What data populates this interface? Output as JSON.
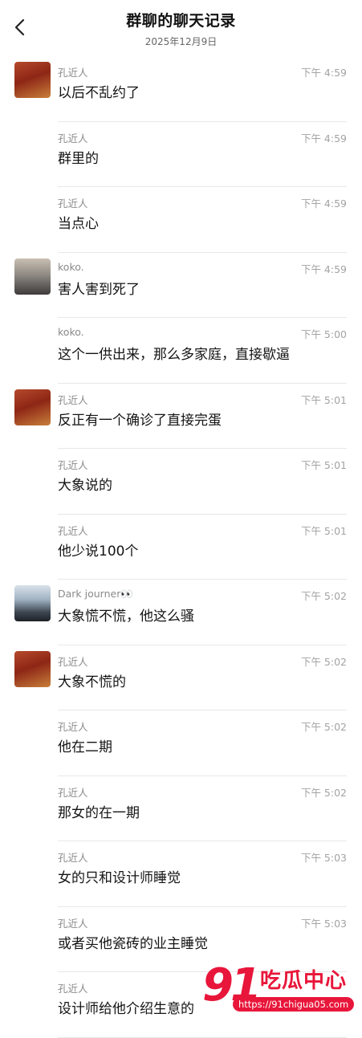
{
  "header": {
    "title": "群聊的聊天记录",
    "subtitle": "2025年12月9日"
  },
  "messages": [
    {
      "sender": "孔近人",
      "time": "下午 4:59",
      "text": "以后不乱约了",
      "avatar": "kong"
    },
    {
      "sender": "孔近人",
      "time": "下午 4:59",
      "text": "群里的",
      "avatar": null
    },
    {
      "sender": "孔近人",
      "time": "下午 4:59",
      "text": "当点心",
      "avatar": null
    },
    {
      "sender": "koko.",
      "time": "下午 4:59",
      "text": "害人害到死了",
      "avatar": "koko"
    },
    {
      "sender": "koko.",
      "time": "下午 5:00",
      "text": "这个一供出来，那么多家庭，直接歇逼",
      "avatar": null
    },
    {
      "sender": "孔近人",
      "time": "下午 5:01",
      "text": "反正有一个确诊了直接完蛋",
      "avatar": "kong"
    },
    {
      "sender": "孔近人",
      "time": "下午 5:01",
      "text": "大象说的",
      "avatar": null
    },
    {
      "sender": "孔近人",
      "time": "下午 5:01",
      "text": "他少说100个",
      "avatar": null
    },
    {
      "sender": "Dark journer👀",
      "time": "下午 5:02",
      "text": "大象慌不慌，他这么骚",
      "avatar": "dark"
    },
    {
      "sender": "孔近人",
      "time": "下午 5:02",
      "text": "大象不慌的",
      "avatar": "kong"
    },
    {
      "sender": "孔近人",
      "time": "下午 5:02",
      "text": "他在二期",
      "avatar": null
    },
    {
      "sender": "孔近人",
      "time": "下午 5:02",
      "text": "那女的在一期",
      "avatar": null
    },
    {
      "sender": "孔近人",
      "time": "下午 5:03",
      "text": "女的只和设计师睡觉",
      "avatar": null
    },
    {
      "sender": "孔近人",
      "time": "下午 5:03",
      "text": "或者买他瓷砖的业主睡觉",
      "avatar": null
    },
    {
      "sender": "孔近人",
      "time": "",
      "text": "设计师给他介绍生意的",
      "avatar": null
    }
  ],
  "watermark": {
    "number": "91",
    "name": "吃瓜中心",
    "url": "https://91chigua05.com"
  }
}
